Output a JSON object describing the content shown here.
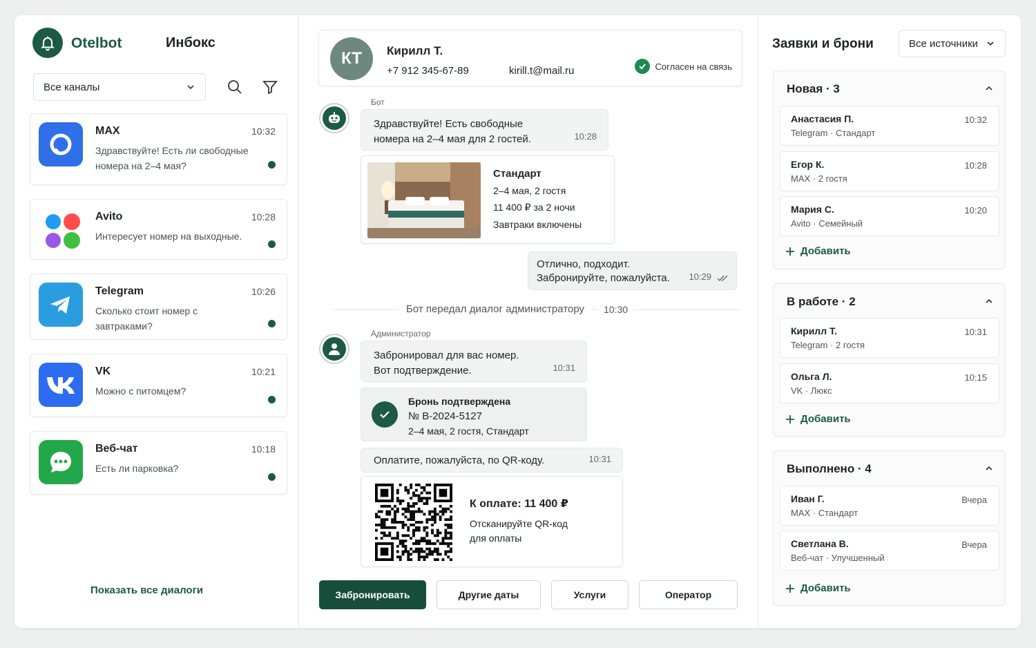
{
  "app": {
    "brand": "Otelbot",
    "inbox_title": "Инбокс"
  },
  "left": {
    "channel_filter": "Все каналы",
    "conversations": [
      {
        "name": "MAX",
        "time": "10:32",
        "message": "Здравствуйте! Есть ли свободные номера на 2–4 мая?"
      },
      {
        "name": "Avito",
        "time": "10:28",
        "message": "Интересует номер на выходные."
      },
      {
        "name": "Telegram",
        "time": "10:26",
        "message": "Сколько стоит номер с завтраками?"
      },
      {
        "name": "VK",
        "time": "10:21",
        "message": "Можно с питомцем?"
      },
      {
        "name": "Веб-чат",
        "time": "10:18",
        "message": "Есть ли парковка?"
      }
    ],
    "show_all": "Показать все диалоги"
  },
  "chat": {
    "contact": {
      "initials": "КТ",
      "name": "Кирилл Т.",
      "phone": "+7 912 345-67-89",
      "email": "kirill.t@mail.ru",
      "consent": "Согласен на связь"
    },
    "bot_label": "Бот",
    "bot_msg": {
      "text1": "Здравствуйте! Есть свободные",
      "text2": "номера на 2–4 мая для 2 гостей.",
      "time": "10:28"
    },
    "room_card": {
      "title": "Стандарт",
      "line1": "2–4 мая, 2 гостя",
      "line2": "11 400 ₽ за 2 ночи",
      "line3": "Завтраки включены"
    },
    "user_msg": {
      "text1": "Отлично, подходит.",
      "text2": "Забронируйте, пожалуйста.",
      "time": "10:29"
    },
    "handoff": {
      "text": "Бот передал диалог администратору",
      "time": "10:30"
    },
    "admin_label": "Администратор",
    "admin_msg": {
      "text1": "Забронировал для вас номер.",
      "text2": "Вот подтверждение.",
      "time": "10:31"
    },
    "confirm": {
      "title": "Бронь подтверждена",
      "number": "№ B-2024-5127",
      "details": "2–4 мая, 2 гостя, Стандарт"
    },
    "pay_msg": {
      "text": "Оплатите, пожалуйста, по QR-коду.",
      "time": "10:31"
    },
    "pay_card": {
      "title": "К оплате: 11 400 ₽",
      "line1": "Отсканируйте QR-код",
      "line2": "для оплаты"
    },
    "actions": {
      "book": "Забронировать",
      "other_dates": "Другие даты",
      "services": "Услуги",
      "operator": "Оператор"
    }
  },
  "right": {
    "title": "Заявки и брони",
    "source_filter": "Все источники",
    "groups": [
      {
        "title": "Новая · 3",
        "items": [
          {
            "name": "Анастасия П.",
            "sub": "Telegram · Стандарт",
            "time": "10:32"
          },
          {
            "name": "Егор К.",
            "sub": "MAX · 2 гостя",
            "time": "10:28"
          },
          {
            "name": "Мария С.",
            "sub": "Avito · Семейный",
            "time": "10:20"
          }
        ]
      },
      {
        "title": "В работе · 2",
        "items": [
          {
            "name": "Кирилл Т.",
            "sub": "Telegram · 2 гостя",
            "time": "10:31"
          },
          {
            "name": "Ольга Л.",
            "sub": "VK · Люкс",
            "time": "10:15"
          }
        ]
      },
      {
        "title": "Выполнено · 4",
        "items": [
          {
            "name": "Иван Г.",
            "sub": "MAX · Стандарт",
            "time": "Вчера"
          },
          {
            "name": "Светлана В.",
            "sub": "Веб-чат · Улучшенный",
            "time": "Вчера"
          }
        ]
      }
    ],
    "add_label": "Добавить"
  },
  "colors": {
    "brand": "#1c5a45",
    "max": "#2f6fe8",
    "telegram": "#2a9de0",
    "vk": "#2d6cf0",
    "webchat": "#22a84a"
  }
}
